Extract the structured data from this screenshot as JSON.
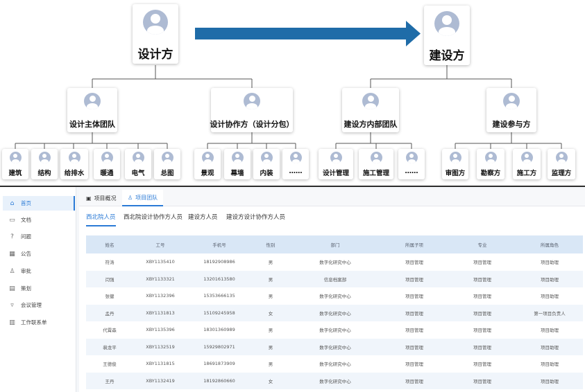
{
  "org_chart": {
    "top_left_label": "设计方",
    "top_right_label": "建设方",
    "arrow_color": "#1f6ca8",
    "mid_labels": [
      "设计主体团队",
      "设计协作方（设计分包）",
      "建设方内部团队",
      "建设参与方"
    ],
    "leaf_labels": [
      "建筑",
      "结构",
      "给排水",
      "暖通",
      "电气",
      "总图",
      "景观",
      "幕墙",
      "内装",
      "……",
      "设计管理",
      "施工管理",
      "……",
      "审图方",
      "勘察方",
      "施工方",
      "监理方"
    ]
  },
  "sidebar": {
    "items": [
      {
        "icon": "home-icon",
        "label": "首页"
      },
      {
        "icon": "document-icon",
        "label": "文档"
      },
      {
        "icon": "question-icon",
        "label": "问题"
      },
      {
        "icon": "announcement-icon",
        "label": "公告"
      },
      {
        "icon": "user-approval-icon",
        "label": "审批"
      },
      {
        "icon": "plan-icon",
        "label": "策划"
      },
      {
        "icon": "meeting-icon",
        "label": "会议管理"
      },
      {
        "icon": "contact-sheet-icon",
        "label": "工作联系单"
      }
    ]
  },
  "tabs": [
    {
      "icon": "clipboard-icon",
      "label": "项目概况"
    },
    {
      "icon": "user-icon",
      "label": "项目团队"
    }
  ],
  "subtabs": [
    "西北院人员",
    "西北院设计协作方人员",
    "建设方人员",
    "建设方设计协作方人员"
  ],
  "accent_color": "#2a7ad6",
  "table": {
    "headers": [
      "姓名",
      "工号",
      "手机号",
      "性别",
      "部门",
      "所属子项",
      "专业",
      "所属角色"
    ],
    "rows": [
      [
        "符涛",
        "XBY1135410",
        "18192908986",
        "男",
        "数字化研究中心",
        "项目管理",
        "项目管理",
        "项目助理"
      ],
      [
        "闫强",
        "XBY1133321",
        "13201613580",
        "男",
        "信息档案部",
        "项目管理",
        "项目管理",
        "项目助理"
      ],
      [
        "张健",
        "XBY1132396",
        "15353666135",
        "男",
        "数字化研究中心",
        "项目管理",
        "项目管理",
        "项目助理"
      ],
      [
        "孟丹",
        "XBY1131813",
        "15109245958",
        "女",
        "数字化研究中心",
        "项目管理",
        "项目管理",
        "第一项目负责人"
      ],
      [
        "代霄森",
        "XBY1135396",
        "18301360989",
        "男",
        "数字化研究中心",
        "项目管理",
        "项目管理",
        "项目助理"
      ],
      [
        "裴龙平",
        "XBY1132519",
        "15929802971",
        "男",
        "数字化研究中心",
        "项目管理",
        "项目管理",
        "项目助理"
      ],
      [
        "王德俊",
        "XBY1131815",
        "18691873909",
        "男",
        "数字化研究中心",
        "项目管理",
        "项目管理",
        "项目助理"
      ],
      [
        "王丹",
        "XBY1132419",
        "18192860660",
        "女",
        "数字化研究中心",
        "项目管理",
        "项目管理",
        "项目助理"
      ]
    ]
  }
}
